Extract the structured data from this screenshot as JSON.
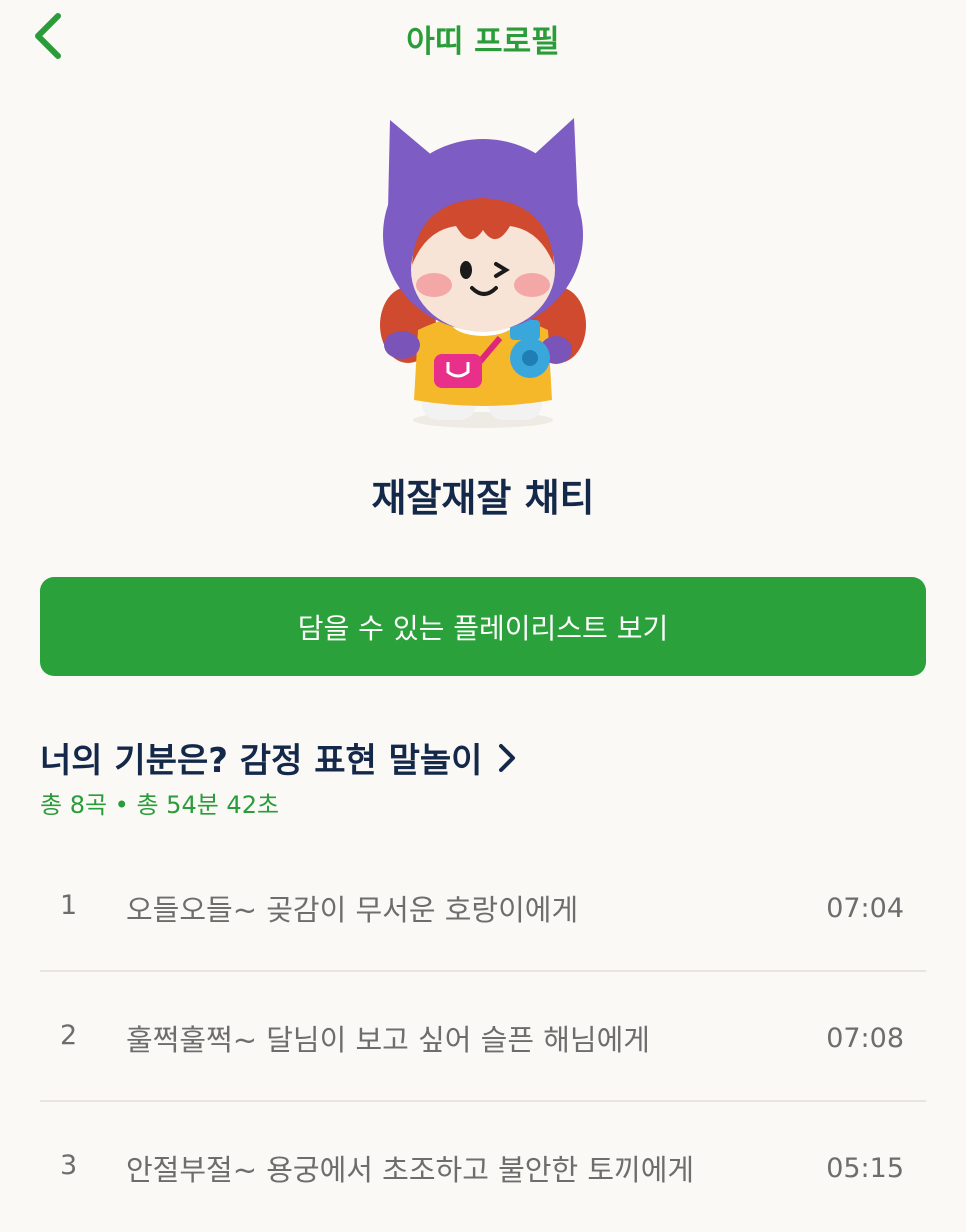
{
  "header": {
    "title": "아띠 프로필",
    "back_icon": "chevron-left-icon",
    "accent_color": "#2a9c3a"
  },
  "character": {
    "name": "재잘재잘 채티",
    "image": "character-illustration"
  },
  "playlist_button": {
    "label": "담을 수 있는 플레이리스트 보기",
    "color": "#2aa13a"
  },
  "section": {
    "title": "너의 기분은? 감정 표현 말놀이",
    "meta": "총 8곡 • 총 54분 42초",
    "chevron_icon": "chevron-right-icon"
  },
  "tracks": [
    {
      "number": "1",
      "title": "오들오들~ 곶감이 무서운 호랑이에게",
      "duration": "07:04"
    },
    {
      "number": "2",
      "title": "훌쩍훌쩍~ 달님이 보고 싶어 슬픈 해님에게",
      "duration": "07:08"
    },
    {
      "number": "3",
      "title": "안절부절~ 용궁에서 초조하고 불안한 토끼에게",
      "duration": "05:15"
    }
  ]
}
